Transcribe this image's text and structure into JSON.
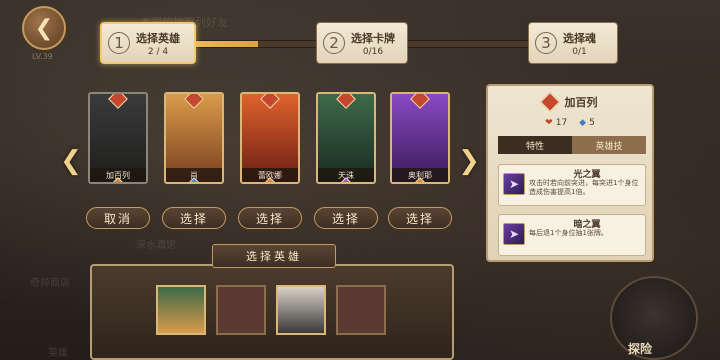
{
  "background": {
    "ghost_labels": [
      "本周的加百列好友",
      "LV.39",
      "深水酒馆",
      "奇异商店",
      "英雄"
    ]
  },
  "progress": {
    "fraction": 0.25,
    "steps": [
      {
        "num": "1",
        "label": "选择英雄",
        "count": "2 / 4",
        "active": true
      },
      {
        "num": "2",
        "label": "选择卡牌",
        "count": "0/16",
        "active": false
      },
      {
        "num": "3",
        "label": "选择魂",
        "count": "0/1",
        "active": false
      }
    ]
  },
  "heroes": [
    {
      "name": "加百列",
      "button": "取消",
      "selected": true,
      "gem": "#d9823a",
      "art": [
        "#3a3a3a",
        "#1e1f1c"
      ]
    },
    {
      "name": "肖",
      "button": "选择",
      "selected": false,
      "gem": "#4a8ad4",
      "art": [
        "#d99b4a",
        "#7a3e1e"
      ]
    },
    {
      "name": "蕾欧娜",
      "button": "选择",
      "selected": false,
      "gem": "#d9823a",
      "art": [
        "#e0622c",
        "#6a1e14"
      ]
    },
    {
      "name": "天诛",
      "button": "选择",
      "selected": false,
      "gem": "#a55ad4",
      "art": [
        "#3d6a4a",
        "#1a2a20"
      ]
    },
    {
      "name": "奥利耶",
      "button": "选择",
      "selected": false,
      "gem": "#d9823a",
      "art": [
        "#8a4ac4",
        "#3a1a5a"
      ]
    }
  ],
  "detail": {
    "name": "加百列",
    "hp": "17",
    "mp": "5",
    "tabs": [
      "特性",
      "英雄技"
    ],
    "skills": [
      {
        "name": "光之翼",
        "desc": "攻击时若向前突进，每突进1个身位造成伤害提高1倍。"
      },
      {
        "name": "暗之翼",
        "desc": "每后退1个身位抽1张牌。"
      }
    ]
  },
  "selected_panel": {
    "title": "选择英雄",
    "slots": [
      {
        "filled": true,
        "colors": [
          "#3d6a4a",
          "#d99b4a"
        ]
      },
      {
        "filled": false
      },
      {
        "filled": true,
        "colors": [
          "#d8d0c4",
          "#3a3a3a"
        ]
      },
      {
        "filled": false
      }
    ]
  },
  "explore_label": "探险"
}
